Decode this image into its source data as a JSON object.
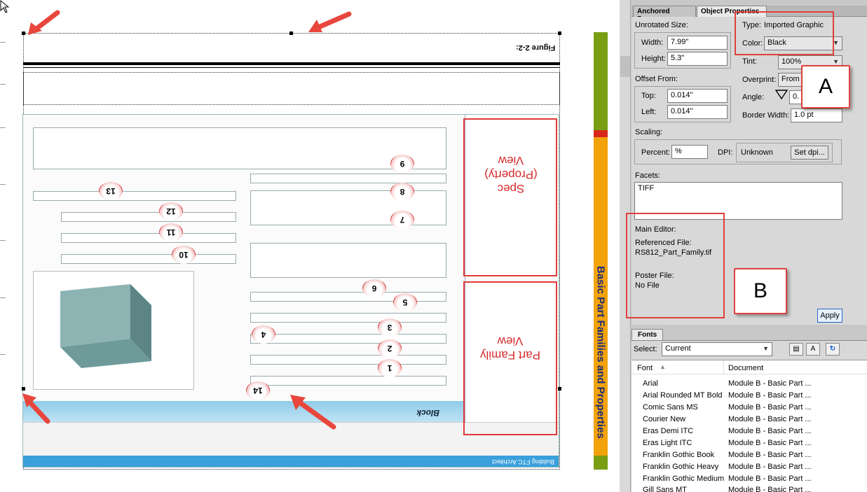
{
  "document": {
    "figure_caption": "Figure 2-2: ",
    "sidebar_caption": "Basic Part Families and Properties",
    "colors": {
      "green": "#7a9e13",
      "red": "#d8261c",
      "orange": "#f2a20a",
      "arrow": "#e8463c"
    },
    "embedded_screenshot": {
      "note_flipped": true,
      "window_title": "Building FTC Architect",
      "block_heading": "Block",
      "pane_spec_label": "Spec (Property) View",
      "pane_family_label": "Part Family View",
      "callouts": [
        "1",
        "2",
        "3",
        "4",
        "5",
        "6",
        "7",
        "8",
        "9",
        "10",
        "11",
        "12",
        "13",
        "14"
      ]
    }
  },
  "panel": {
    "tabs": {
      "anchored_frame": "Anchored Frame",
      "object_properties": "Object Properties"
    },
    "unrotated_size": {
      "heading": "Unrotated Size:",
      "width_label": "Width:",
      "width_value": "7.99\"",
      "height_label": "Height:",
      "height_value": "5.3\""
    },
    "type": {
      "label": "Type:",
      "value": "Imported Graphic"
    },
    "color": {
      "label": "Color:",
      "value": "Black"
    },
    "tint": {
      "label": "Tint:",
      "value": "100%"
    },
    "overprint": {
      "label": "Overprint:",
      "value": "From C"
    },
    "angle": {
      "label": "Angle:",
      "value": "0."
    },
    "border_width": {
      "label": "Border Width:",
      "value": "1.0 pt"
    },
    "offset_from": {
      "heading": "Offset From:",
      "top_label": "Top:",
      "top_value": "0.014\"",
      "left_label": "Left:",
      "left_value": "0.014\""
    },
    "scaling": {
      "heading": "Scaling:",
      "percent_label": "Percent:",
      "percent_value": "%",
      "dpi_label": "DPI:",
      "dpi_value": "Unknown",
      "set_dpi_button": "Set dpi..."
    },
    "facets": {
      "heading": "Facets:",
      "value": "TIFF"
    },
    "main_editor_label": "Main Editor:",
    "referenced_file": {
      "label": "Referenced File:",
      "value": "RS812_Part_Family.tif"
    },
    "poster_file": {
      "label": "Poster File:",
      "value": "No File"
    },
    "apply_button": "Apply",
    "callout_a": "A",
    "callout_b": "B"
  },
  "fonts_pane": {
    "tab": "Fonts",
    "select_label": "Select:",
    "select_value": "Current",
    "column_font": "Font",
    "column_document": "Document",
    "rows": [
      {
        "font": "Arial",
        "document": "Module B - Basic Part ..."
      },
      {
        "font": "Arial Rounded MT Bold",
        "document": "Module B - Basic Part ..."
      },
      {
        "font": "Comic Sans MS",
        "document": "Module B - Basic Part ..."
      },
      {
        "font": "Courier New",
        "document": "Module B - Basic Part ..."
      },
      {
        "font": "Eras Demi ITC",
        "document": "Module B - Basic Part ..."
      },
      {
        "font": "Eras Light ITC",
        "document": "Module B - Basic Part ..."
      },
      {
        "font": "Franklin Gothic Book",
        "document": "Module B - Basic Part ..."
      },
      {
        "font": "Franklin Gothic Heavy",
        "document": "Module B - Basic Part ..."
      },
      {
        "font": "Franklin Gothic Medium",
        "document": "Module B - Basic Part ..."
      },
      {
        "font": "Gill Sans MT",
        "document": "Module B - Basic Part ..."
      }
    ]
  }
}
